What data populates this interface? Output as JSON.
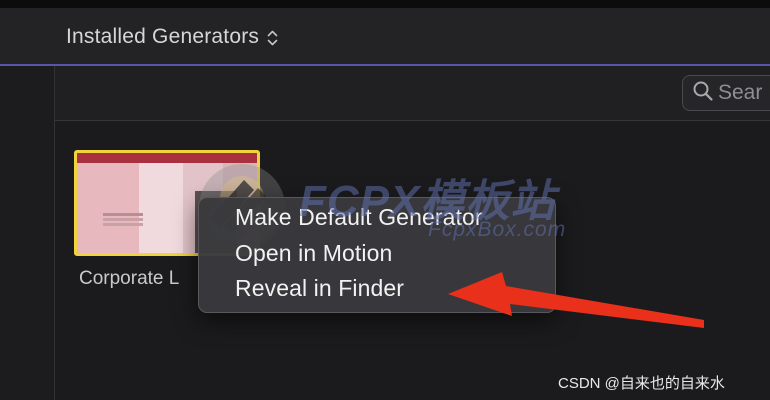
{
  "header": {
    "title": "Installed Generators"
  },
  "search": {
    "placeholder": "Sear"
  },
  "generator": {
    "label": "Corporate L"
  },
  "context_menu": {
    "items": [
      "Make Default Generator",
      "Open in Motion",
      "Reveal in Finder"
    ]
  },
  "watermark": {
    "title": "FCPX模板站",
    "subtitle": "FcpxBox.com"
  },
  "credit": "CSDN @自来也的自来水",
  "colors": {
    "selection": "#f1d33b",
    "arrow": "#e8301a",
    "accent_line": "#5856a8"
  },
  "icons": [
    "chevron-updown-icon",
    "search-icon",
    "watermark-logo-icon",
    "red-arrow-annotation"
  ]
}
